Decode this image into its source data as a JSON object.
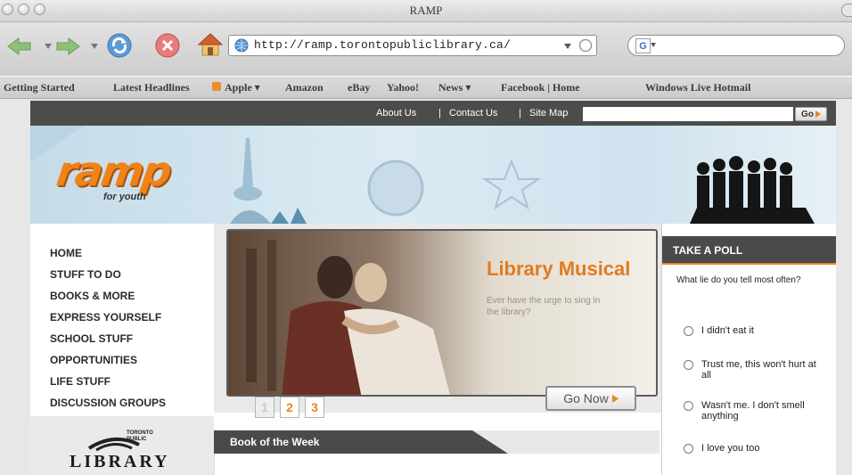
{
  "window": {
    "title": "RAMP"
  },
  "browser": {
    "url": "http://ramp.torontopubliclibrary.ca/",
    "bookmarks": [
      "Getting Started",
      "Latest Headlines",
      "Apple ▾",
      "Amazon",
      "eBay",
      "Yahoo!",
      "News ▾",
      "Facebook | Home",
      "Windows Live Hotmail"
    ]
  },
  "site": {
    "top_links": {
      "about": "About Us",
      "sep1": "|",
      "contact": "Contact Us",
      "sep2": "|",
      "sitemap": "Site Map"
    },
    "search_go": "Go",
    "logo": {
      "wordmark": "ramp",
      "tagline": "for youth"
    },
    "nav": [
      "HOME",
      "STUFF TO DO",
      "BOOKS & MORE",
      "EXPRESS YOURSELF",
      "SCHOOL STUFF",
      "OPPORTUNITIES",
      "LIFE STUFF",
      "DISCUSSION GROUPS"
    ],
    "library_logo": {
      "wordmark": "LIBRARY",
      "small": "TORONTO PUBLIC"
    },
    "feature": {
      "title": "Library Musical",
      "description": "Ever have the urge to sing in the library?",
      "pages": [
        "1",
        "2",
        "3"
      ],
      "active_page": "1",
      "cta": "Go Now"
    },
    "book_of_week": {
      "title": "Book of the Week"
    },
    "poll": {
      "heading": "TAKE A POLL",
      "question": "What lie do you tell most often?",
      "options": [
        "I didn't eat it",
        "Trust me, this won't hurt at all",
        "Wasn't me. I don't smell anything",
        "I love you too"
      ]
    }
  },
  "colors": {
    "brand_orange": "#ef8317",
    "dark_bar": "#4a4a48",
    "banner_blue": "#cfe2ee"
  },
  "icons": [
    "back-arrow-icon",
    "forward-arrow-icon",
    "reload-icon",
    "stop-icon",
    "home-icon",
    "globe-icon",
    "rss-icon",
    "google-icon"
  ]
}
